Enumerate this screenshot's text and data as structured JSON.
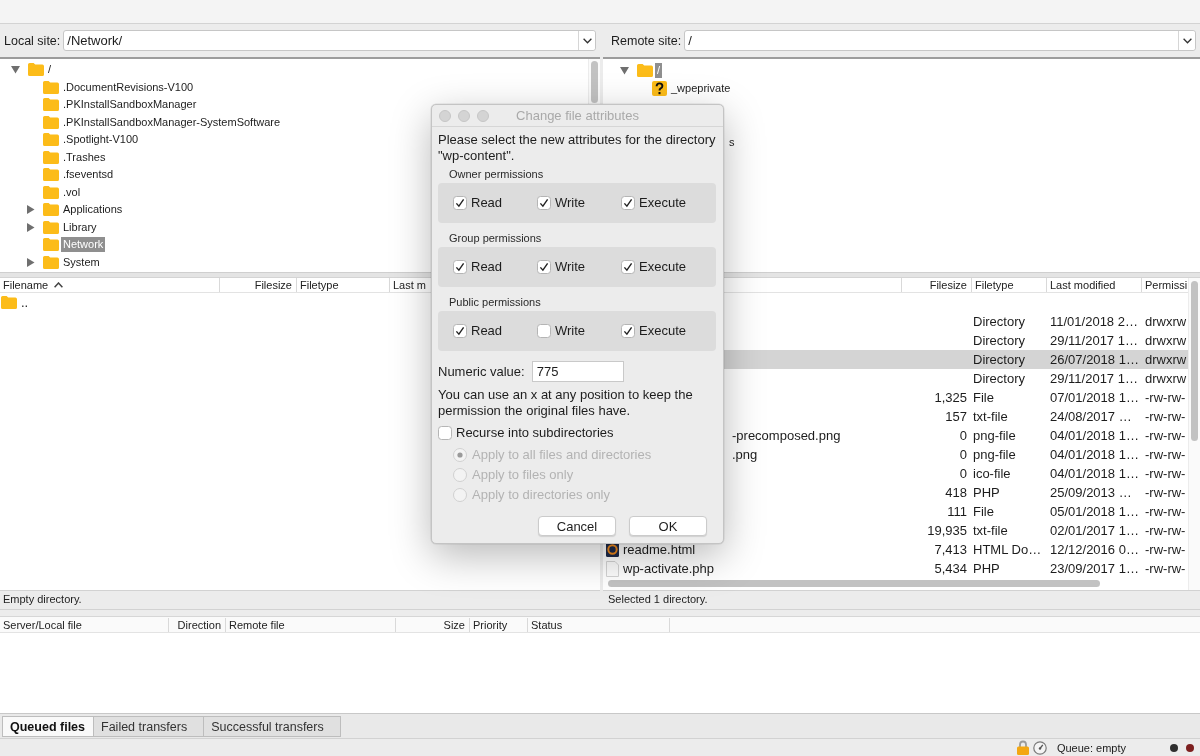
{
  "local_site": {
    "label": "Local site:",
    "path": "/Network/"
  },
  "local_tree": [
    {
      "label": "/",
      "kind": "folder",
      "expanded": true,
      "selected": false,
      "children": [
        {
          "label": ".DocumentRevisions-V100",
          "kind": "folder",
          "selected": false
        },
        {
          "label": ".PKInstallSandboxManager",
          "kind": "folder",
          "selected": false
        },
        {
          "label": ".PKInstallSandboxManager-SystemSoftware",
          "kind": "folder",
          "selected": false
        },
        {
          "label": ".Spotlight-V100",
          "kind": "folder",
          "selected": false
        },
        {
          "label": ".Trashes",
          "kind": "folder",
          "selected": false
        },
        {
          "label": ".fseventsd",
          "kind": "folder",
          "selected": false
        },
        {
          "label": ".vol",
          "kind": "folder",
          "selected": false
        },
        {
          "label": "Applications",
          "kind": "folder",
          "expanded": false,
          "selected": false
        },
        {
          "label": "Library",
          "kind": "folder",
          "expanded": false,
          "selected": false
        },
        {
          "label": "Network",
          "kind": "folder",
          "selected": true
        },
        {
          "label": "System",
          "kind": "folder",
          "expanded": false,
          "selected": false
        }
      ]
    }
  ],
  "local_files": {
    "columns": [
      {
        "label": "Filename",
        "sorted": true
      },
      {
        "label": "Filesize",
        "sorted": false
      },
      {
        "label": "Filetype",
        "sorted": false
      },
      {
        "label": "Last m"
      }
    ],
    "rows": [
      {
        "name": "..",
        "kind": "folder",
        "selected": false
      }
    ]
  },
  "local_status": "Empty directory.",
  "remote_site": {
    "label": "Remote site:",
    "path": "/"
  },
  "remote_tree": [
    {
      "label": "/",
      "kind": "folder",
      "expanded": true,
      "selected": true,
      "children": [
        {
          "label": "_wpeprivate",
          "kind": "unknown",
          "selected": false
        },
        {
          "kind": "covered"
        },
        {
          "kind": "covered"
        },
        {
          "label": "s",
          "kind": "covered"
        }
      ]
    }
  ],
  "remote_files": {
    "columns": [
      {
        "label": "Filesize"
      },
      {
        "label": "Filetype"
      },
      {
        "label": "Last modified"
      },
      {
        "label": "Permissi"
      }
    ],
    "rows": [
      {
        "kind": "covered",
        "selected": false
      },
      {
        "kind": "covered",
        "type": "Directory",
        "modified": "11/01/2018 2…",
        "permissions": "drwxrw",
        "selected": false
      },
      {
        "kind": "covered",
        "type": "Directory",
        "modified": "29/11/2017 1…",
        "permissions": "drwxrw",
        "selected": false
      },
      {
        "kind": "covered",
        "type": "Directory",
        "modified": "26/07/2018 1…",
        "permissions": "drwxrw",
        "selected": true
      },
      {
        "kind": "covered",
        "type": "Directory",
        "modified": "29/11/2017 1…",
        "permissions": "drwxrw",
        "selected": false
      },
      {
        "kind": "covered",
        "size": "1,325",
        "type": "File",
        "modified": "07/01/2018 1…",
        "permissions": "-rw-rw-",
        "selected": false
      },
      {
        "kind": "covered",
        "size": "157",
        "type": "txt-file",
        "modified": "24/08/2017 …",
        "permissions": "-rw-rw-",
        "selected": false
      },
      {
        "kind": "covered",
        "name": "-precomposed.png",
        "size": "0",
        "type": "png-file",
        "modified": "04/01/2018 1…",
        "permissions": "-rw-rw-",
        "selected": false
      },
      {
        "kind": "covered",
        "name": ".png",
        "size": "0",
        "type": "png-file",
        "modified": "04/01/2018 1…",
        "permissions": "-rw-rw-",
        "selected": false
      },
      {
        "kind": "covered",
        "size": "0",
        "type": "ico-file",
        "modified": "04/01/2018 1…",
        "permissions": "-rw-rw-",
        "selected": false
      },
      {
        "kind": "covered",
        "size": "418",
        "type": "PHP",
        "modified": "25/09/2013 …",
        "permissions": "-rw-rw-",
        "selected": false
      },
      {
        "kind": "covered",
        "size": "111",
        "type": "File",
        "modified": "05/01/2018 1…",
        "permissions": "-rw-rw-",
        "selected": false
      },
      {
        "kind": "covered",
        "size": "19,935",
        "type": "txt-file",
        "modified": "02/01/2017 1…",
        "permissions": "-rw-rw-",
        "selected": false
      },
      {
        "kind": "web_page",
        "name": "readme.html",
        "size": "7,413",
        "type": "HTML Do…",
        "modified": "12/12/2016 0…",
        "permissions": "-rw-rw-",
        "selected": false
      },
      {
        "kind": "document",
        "name": "wp-activate.php",
        "size": "5,434",
        "type": "PHP",
        "modified": "23/09/2017 1…",
        "permissions": "-rw-rw-",
        "selected": false
      }
    ]
  },
  "remote_status": "Selected 1 directory.",
  "dialog": {
    "title": "Change file attributes",
    "intro": "Please select the new attributes for the directory \"wp-content\".",
    "groups": [
      {
        "title": "Owner permissions",
        "permissions": [
          {
            "label": "Read",
            "checked": true
          },
          {
            "label": "Write",
            "checked": true
          },
          {
            "label": "Execute",
            "checked": true
          }
        ]
      },
      {
        "title": "Group permissions",
        "permissions": [
          {
            "label": "Read",
            "checked": true
          },
          {
            "label": "Write",
            "checked": true
          },
          {
            "label": "Execute",
            "checked": true
          }
        ]
      },
      {
        "title": "Public permissions",
        "permissions": [
          {
            "label": "Read",
            "checked": true
          },
          {
            "label": "Write",
            "checked": false
          },
          {
            "label": "Execute",
            "checked": true
          }
        ]
      }
    ],
    "numeric_label": "Numeric value:",
    "numeric_value": "775",
    "hint": "You can use an x at any position to keep the permission the original files have.",
    "recurse": {
      "label": "Recurse into subdirectories",
      "checked": false
    },
    "apply_options": [
      {
        "label": "Apply to all files and directories",
        "selected": true,
        "disabled": true
      },
      {
        "label": "Apply to files only",
        "selected": false,
        "disabled": true
      },
      {
        "label": "Apply to directories only",
        "selected": false,
        "disabled": true
      }
    ],
    "buttons": [
      "Cancel",
      "OK"
    ]
  },
  "queue": {
    "columns": [
      "Server/Local file",
      "Direction",
      "Remote file",
      "Size",
      "Priority",
      "Status"
    ]
  },
  "queue_tabs": [
    {
      "label": "Queued files",
      "selected": true
    },
    {
      "label": "Failed transfers",
      "selected": false
    },
    {
      "label": "Successful transfers",
      "selected": false
    }
  ],
  "status_bar": {
    "queue": "Queue: empty",
    "indicators": [
      {
        "color": "#2f2f2f"
      },
      {
        "color": "#7d2020"
      }
    ]
  }
}
